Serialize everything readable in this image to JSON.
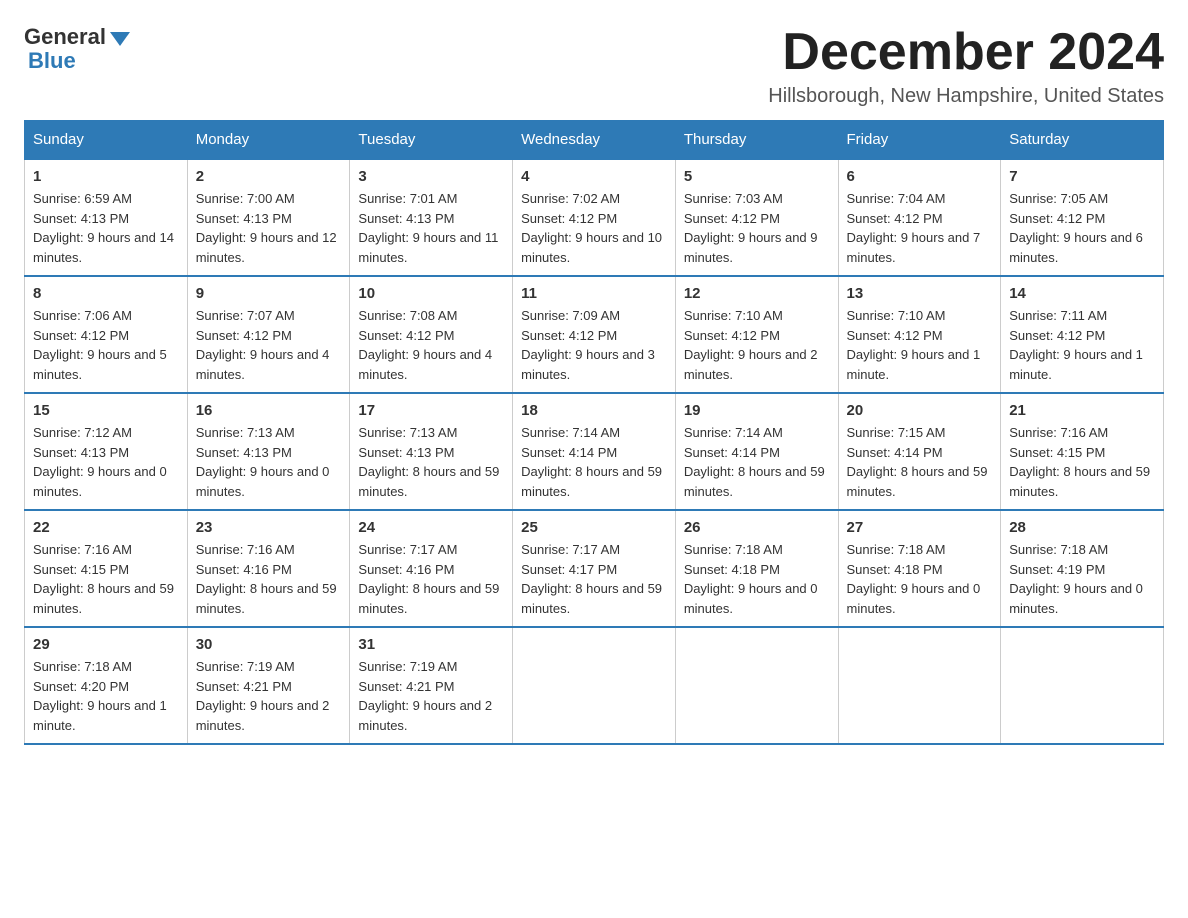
{
  "logo": {
    "general": "General",
    "blue": "Blue"
  },
  "header": {
    "month_title": "December 2024",
    "location": "Hillsborough, New Hampshire, United States"
  },
  "days_of_week": [
    "Sunday",
    "Monday",
    "Tuesday",
    "Wednesday",
    "Thursday",
    "Friday",
    "Saturday"
  ],
  "weeks": [
    [
      {
        "day": "1",
        "sunrise": "6:59 AM",
        "sunset": "4:13 PM",
        "daylight": "9 hours and 14 minutes."
      },
      {
        "day": "2",
        "sunrise": "7:00 AM",
        "sunset": "4:13 PM",
        "daylight": "9 hours and 12 minutes."
      },
      {
        "day": "3",
        "sunrise": "7:01 AM",
        "sunset": "4:13 PM",
        "daylight": "9 hours and 11 minutes."
      },
      {
        "day": "4",
        "sunrise": "7:02 AM",
        "sunset": "4:12 PM",
        "daylight": "9 hours and 10 minutes."
      },
      {
        "day": "5",
        "sunrise": "7:03 AM",
        "sunset": "4:12 PM",
        "daylight": "9 hours and 9 minutes."
      },
      {
        "day": "6",
        "sunrise": "7:04 AM",
        "sunset": "4:12 PM",
        "daylight": "9 hours and 7 minutes."
      },
      {
        "day": "7",
        "sunrise": "7:05 AM",
        "sunset": "4:12 PM",
        "daylight": "9 hours and 6 minutes."
      }
    ],
    [
      {
        "day": "8",
        "sunrise": "7:06 AM",
        "sunset": "4:12 PM",
        "daylight": "9 hours and 5 minutes."
      },
      {
        "day": "9",
        "sunrise": "7:07 AM",
        "sunset": "4:12 PM",
        "daylight": "9 hours and 4 minutes."
      },
      {
        "day": "10",
        "sunrise": "7:08 AM",
        "sunset": "4:12 PM",
        "daylight": "9 hours and 4 minutes."
      },
      {
        "day": "11",
        "sunrise": "7:09 AM",
        "sunset": "4:12 PM",
        "daylight": "9 hours and 3 minutes."
      },
      {
        "day": "12",
        "sunrise": "7:10 AM",
        "sunset": "4:12 PM",
        "daylight": "9 hours and 2 minutes."
      },
      {
        "day": "13",
        "sunrise": "7:10 AM",
        "sunset": "4:12 PM",
        "daylight": "9 hours and 1 minute."
      },
      {
        "day": "14",
        "sunrise": "7:11 AM",
        "sunset": "4:12 PM",
        "daylight": "9 hours and 1 minute."
      }
    ],
    [
      {
        "day": "15",
        "sunrise": "7:12 AM",
        "sunset": "4:13 PM",
        "daylight": "9 hours and 0 minutes."
      },
      {
        "day": "16",
        "sunrise": "7:13 AM",
        "sunset": "4:13 PM",
        "daylight": "9 hours and 0 minutes."
      },
      {
        "day": "17",
        "sunrise": "7:13 AM",
        "sunset": "4:13 PM",
        "daylight": "8 hours and 59 minutes."
      },
      {
        "day": "18",
        "sunrise": "7:14 AM",
        "sunset": "4:14 PM",
        "daylight": "8 hours and 59 minutes."
      },
      {
        "day": "19",
        "sunrise": "7:14 AM",
        "sunset": "4:14 PM",
        "daylight": "8 hours and 59 minutes."
      },
      {
        "day": "20",
        "sunrise": "7:15 AM",
        "sunset": "4:14 PM",
        "daylight": "8 hours and 59 minutes."
      },
      {
        "day": "21",
        "sunrise": "7:16 AM",
        "sunset": "4:15 PM",
        "daylight": "8 hours and 59 minutes."
      }
    ],
    [
      {
        "day": "22",
        "sunrise": "7:16 AM",
        "sunset": "4:15 PM",
        "daylight": "8 hours and 59 minutes."
      },
      {
        "day": "23",
        "sunrise": "7:16 AM",
        "sunset": "4:16 PM",
        "daylight": "8 hours and 59 minutes."
      },
      {
        "day": "24",
        "sunrise": "7:17 AM",
        "sunset": "4:16 PM",
        "daylight": "8 hours and 59 minutes."
      },
      {
        "day": "25",
        "sunrise": "7:17 AM",
        "sunset": "4:17 PM",
        "daylight": "8 hours and 59 minutes."
      },
      {
        "day": "26",
        "sunrise": "7:18 AM",
        "sunset": "4:18 PM",
        "daylight": "9 hours and 0 minutes."
      },
      {
        "day": "27",
        "sunrise": "7:18 AM",
        "sunset": "4:18 PM",
        "daylight": "9 hours and 0 minutes."
      },
      {
        "day": "28",
        "sunrise": "7:18 AM",
        "sunset": "4:19 PM",
        "daylight": "9 hours and 0 minutes."
      }
    ],
    [
      {
        "day": "29",
        "sunrise": "7:18 AM",
        "sunset": "4:20 PM",
        "daylight": "9 hours and 1 minute."
      },
      {
        "day": "30",
        "sunrise": "7:19 AM",
        "sunset": "4:21 PM",
        "daylight": "9 hours and 2 minutes."
      },
      {
        "day": "31",
        "sunrise": "7:19 AM",
        "sunset": "4:21 PM",
        "daylight": "9 hours and 2 minutes."
      },
      null,
      null,
      null,
      null
    ]
  ],
  "labels": {
    "sunrise": "Sunrise:",
    "sunset": "Sunset:",
    "daylight": "Daylight:"
  }
}
